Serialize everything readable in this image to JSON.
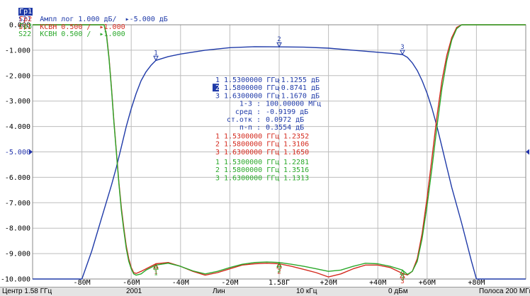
{
  "colors": {
    "trace1": "#1f3aa8",
    "trace2": "#d42a1e",
    "trace3": "#2aa82a",
    "grid": "#bdbdbd",
    "ref": "#2233aa",
    "bar": "#e4e4e4"
  },
  "header": {
    "tr1": {
      "label": "Гр1",
      "text": "S21  Ампл лог 1.000 дБ/  ▸-5.000 дБ"
    },
    "tr2": {
      "label": "Гр2",
      "text": "S11  КСВН 0.500 /  ▸1.000"
    },
    "tr3": {
      "label": "Гр3",
      "text": "S22  КСВН 0.500 /  ▸1.000"
    }
  },
  "markers": {
    "tr1": [
      {
        "idx": "1",
        "freq": "1.5300000 ГГц",
        "val": "-1.1255 дБ",
        "active": false
      },
      {
        "idx": "2",
        "freq": "1.5800000 ГГц",
        "val": "-0.8741 дБ",
        "active": true
      },
      {
        "idx": "3",
        "freq": "1.6300000 ГГц",
        "val": "-1.1670 дБ",
        "active": false
      }
    ],
    "stats": [
      {
        "label": "1-3 :",
        "val": "100.00000 МГц"
      },
      {
        "label": "сред :",
        "val": "-0.9199 дБ"
      },
      {
        "label": "ст.отк :",
        "val": "0.0972 дБ"
      },
      {
        "label": "п-п :",
        "val": "0.3554 дБ"
      }
    ],
    "tr2": [
      {
        "idx": "1",
        "freq": "1.5300000 ГГц",
        "val": "1.2352"
      },
      {
        "idx": "2",
        "freq": "1.5800000 ГГц",
        "val": "1.3106"
      },
      {
        "idx": "3",
        "freq": "1.6300000 ГГц",
        "val": "1.1650"
      }
    ],
    "tr3": [
      {
        "idx": "1",
        "freq": "1.5300000 ГГц",
        "val": "1.2281"
      },
      {
        "idx": "2",
        "freq": "1.5800000 ГГц",
        "val": "1.3516"
      },
      {
        "idx": "3",
        "freq": "1.6300000 ГГц",
        "val": "1.1313"
      }
    ]
  },
  "status": {
    "center": "Центр 1.58 ГГц",
    "points": "2001",
    "sweep": "Лин",
    "ifbw": "10 кГц",
    "power": "0 дБм",
    "span": "Полоса 200 МГц"
  },
  "chart_data": {
    "type": "line",
    "xunit": "МГц (отн. 1.58 ГГц)",
    "xlim": [
      -100,
      100
    ],
    "ylim": [
      -10,
      0
    ],
    "yticks": [
      "0.000",
      "-1.000",
      "-2.000",
      "-3.000",
      "-4.000",
      "-5.000",
      "-6.000",
      "-7.000",
      "-8.000",
      "-9.000",
      "-10.000"
    ],
    "xtick_values": [
      -80,
      -60,
      -40,
      -20,
      0,
      20,
      40,
      60,
      80
    ],
    "xtick_labels": [
      "-80М",
      "-60М",
      "-40М",
      "-20М",
      "1.58Г",
      "+20М",
      "+40М",
      "+60М",
      "+80М"
    ],
    "ref_value": -5,
    "grid": true,
    "series": [
      {
        "x": [
          -100,
          -80,
          -76,
          -72,
          -68,
          -66,
          -64,
          -62,
          -60,
          -58,
          -56,
          -54,
          -52,
          -50,
          -45,
          -40,
          -30,
          -20,
          -10,
          0,
          10,
          20,
          30,
          40,
          45,
          50,
          52,
          54,
          56,
          58,
          60,
          62,
          64,
          66,
          68,
          70,
          74,
          78,
          80,
          100
        ],
        "y": [
          -10,
          -10,
          -8.9,
          -7.6,
          -6.3,
          -5.6,
          -4.8,
          -4.0,
          -3.3,
          -2.7,
          -2.2,
          -1.85,
          -1.6,
          -1.4,
          -1.25,
          -1.15,
          -1.0,
          -0.9,
          -0.86,
          -0.87,
          -0.88,
          -0.92,
          -1.0,
          -1.08,
          -1.12,
          -1.17,
          -1.28,
          -1.5,
          -1.8,
          -2.2,
          -2.7,
          -3.3,
          -4.0,
          -4.8,
          -5.6,
          -6.4,
          -7.8,
          -9.3,
          -10,
          -10
        ]
      },
      {
        "x": [
          -100,
          -71,
          -70,
          -69,
          -68,
          -67,
          -66,
          -65,
          -64,
          -63,
          -62,
          -61,
          -60,
          -59,
          -58,
          -56,
          -54,
          -50,
          -45,
          -40,
          -35,
          -30,
          -25,
          -20,
          -15,
          -10,
          -5,
          0,
          5,
          10,
          15,
          20,
          25,
          30,
          35,
          40,
          45,
          50,
          52,
          54,
          56,
          58,
          60,
          62,
          64,
          66,
          68,
          70,
          72,
          74,
          100
        ],
        "y": [
          0,
          0,
          -0.4,
          -1.3,
          -2.5,
          -3.8,
          -5.0,
          -6.2,
          -7.2,
          -8.0,
          -8.7,
          -9.2,
          -9.55,
          -9.75,
          -9.78,
          -9.7,
          -9.6,
          -9.4,
          -9.35,
          -9.5,
          -9.7,
          -9.85,
          -9.75,
          -9.6,
          -9.45,
          -9.4,
          -9.38,
          -9.4,
          -9.5,
          -9.62,
          -9.75,
          -9.92,
          -9.8,
          -9.6,
          -9.45,
          -9.45,
          -9.55,
          -9.78,
          -9.84,
          -9.7,
          -9.2,
          -8.2,
          -6.8,
          -5.2,
          -3.6,
          -2.2,
          -1.2,
          -0.5,
          -0.1,
          0,
          0
        ]
      },
      {
        "x": [
          -100,
          -71,
          -70,
          -69,
          -68,
          -67,
          -66,
          -65,
          -64,
          -63,
          -62,
          -61,
          -60,
          -59,
          -58,
          -56,
          -54,
          -50,
          -45,
          -40,
          -35,
          -30,
          -25,
          -20,
          -15,
          -10,
          -5,
          0,
          5,
          10,
          15,
          20,
          25,
          30,
          35,
          40,
          45,
          50,
          52,
          54,
          56,
          58,
          60,
          62,
          64,
          66,
          68,
          70,
          72,
          74,
          100
        ],
        "y": [
          0,
          0,
          -0.45,
          -1.35,
          -2.55,
          -3.85,
          -5.05,
          -6.25,
          -7.3,
          -8.1,
          -8.8,
          -9.3,
          -9.6,
          -9.8,
          -9.85,
          -9.8,
          -9.65,
          -9.45,
          -9.38,
          -9.5,
          -9.68,
          -9.8,
          -9.7,
          -9.55,
          -9.42,
          -9.35,
          -9.33,
          -9.35,
          -9.42,
          -9.5,
          -9.6,
          -9.7,
          -9.65,
          -9.5,
          -9.38,
          -9.4,
          -9.5,
          -9.65,
          -9.82,
          -9.7,
          -9.3,
          -8.4,
          -7.1,
          -5.6,
          -4.0,
          -2.5,
          -1.4,
          -0.6,
          -0.15,
          0,
          0
        ]
      }
    ]
  }
}
